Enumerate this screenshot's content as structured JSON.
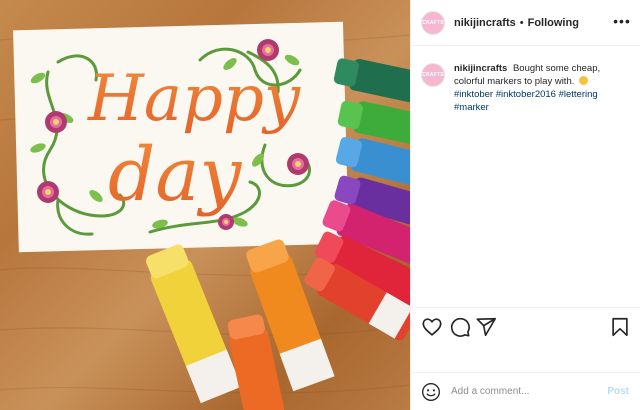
{
  "post": {
    "username": "nikijincrafts",
    "separator": "•",
    "follow_status": "Following",
    "avatar_text": "CRAFTS",
    "caption_text": "Bought some cheap, colorful markers to play with.",
    "hashtags": [
      "#inktober",
      "#inktober2016",
      "#lettering",
      "#marker"
    ],
    "image_lettering": [
      "Happy",
      "day"
    ]
  },
  "add_comment": {
    "placeholder": "Add a comment...",
    "post_label": "Post"
  },
  "colors": {
    "link": "#00376b",
    "post_button_disabled": "#b2dffc",
    "divider": "#efefef"
  },
  "icons": [
    "more-options-icon",
    "heart-icon",
    "comment-icon",
    "share-icon",
    "bookmark-icon",
    "emoji-icon"
  ]
}
